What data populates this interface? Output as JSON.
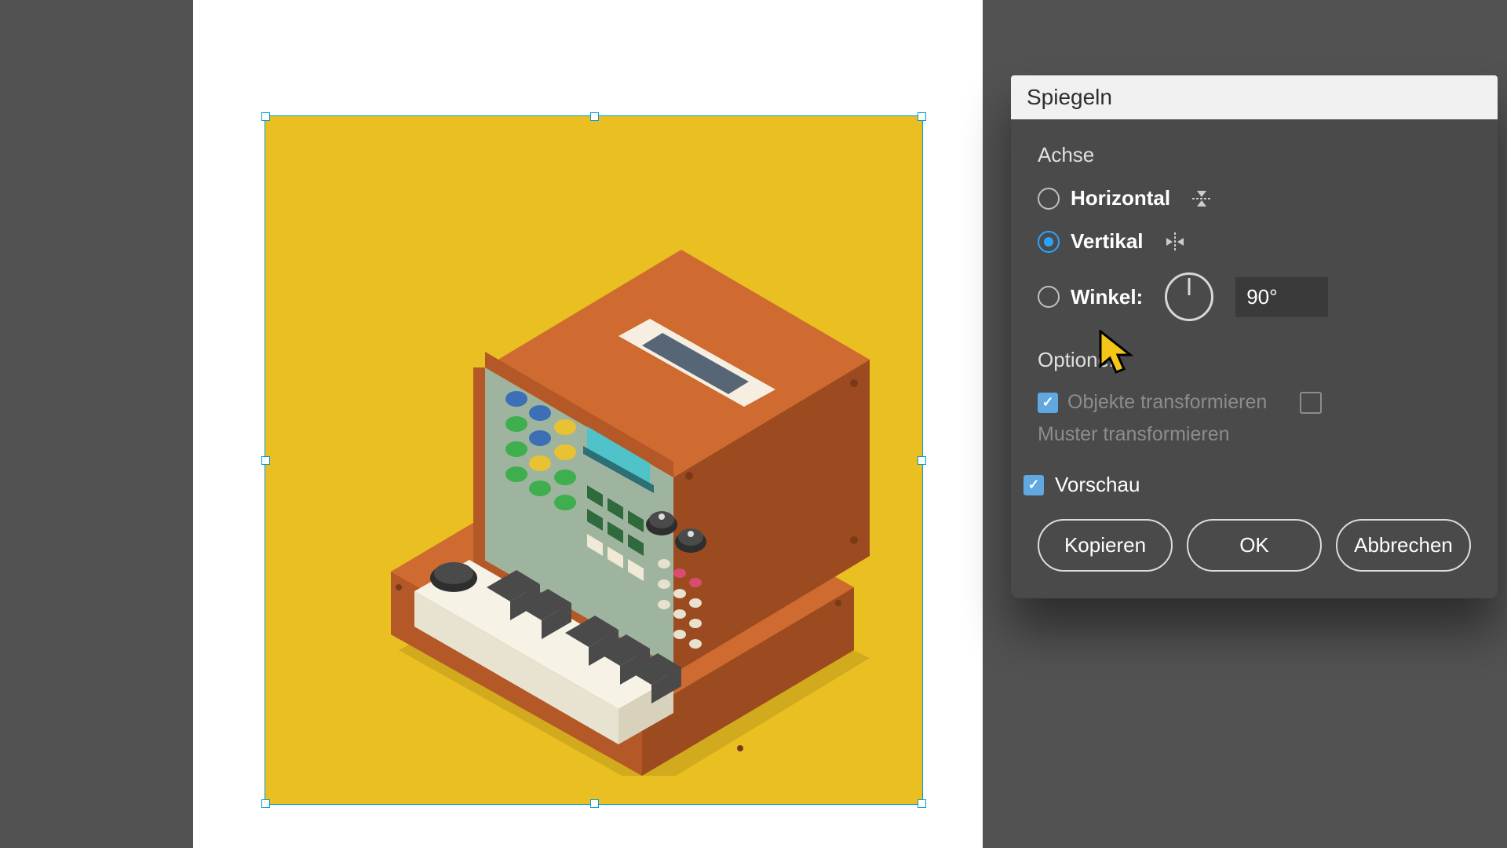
{
  "dialog": {
    "title": "Spiegeln",
    "section_axis": "Achse",
    "radio_horizontal": "Horizontal",
    "radio_vertical": "Vertikal",
    "radio_angle": "Winkel:",
    "angle_value": "90°",
    "section_options": "Optionen",
    "chk_transform_objects": "Objekte transformieren",
    "chk_transform_patterns": "Muster transformieren",
    "chk_preview": "Vorschau",
    "btn_copy": "Kopieren",
    "btn_ok": "OK",
    "btn_cancel": "Abbrechen",
    "selected_axis": "vertical",
    "preview_checked": true,
    "transform_objects_checked": true,
    "transform_patterns_checked": false
  }
}
